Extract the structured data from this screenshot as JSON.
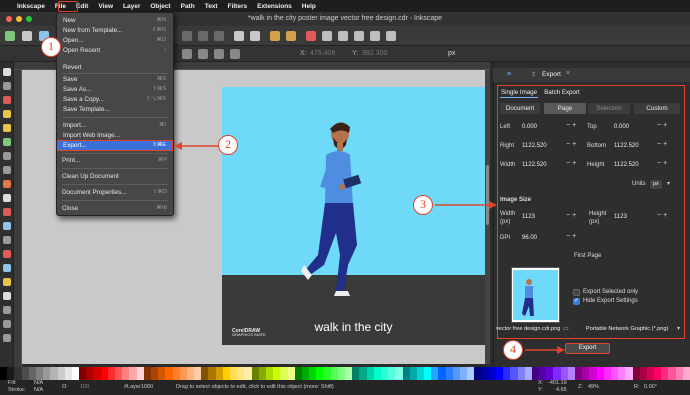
{
  "menubar": {
    "apple": "",
    "items": [
      "Inkscape",
      "File",
      "Edit",
      "View",
      "Layer",
      "Object",
      "Path",
      "Text",
      "Filters",
      "Extensions",
      "Help"
    ]
  },
  "window": {
    "title": "*walk in the city poster image vector free design.cdr - Inkscape"
  },
  "toolctl": {
    "x_label": "X:",
    "x_value": "475.408",
    "y_label": "Y:",
    "y_value": "392.300",
    "unit": "px"
  },
  "file_menu": {
    "items": [
      {
        "label": "New",
        "key": "⌘N"
      },
      {
        "label": "New from Template...",
        "key": "⇧⌘N"
      },
      {
        "label": "Open...",
        "key": "⌘O"
      },
      {
        "label": "Open Recent",
        "key": "›"
      },
      {
        "label": "Revert",
        "key": ""
      },
      {
        "label": "Save",
        "key": "⌘S"
      },
      {
        "label": "Save As...",
        "key": "⇧⌘S"
      },
      {
        "label": "Save a Copy...",
        "key": "⇧⌥⌘S"
      },
      {
        "label": "Save Template...",
        "key": ""
      },
      {
        "label": "Import...",
        "key": "⌘I"
      },
      {
        "label": "Import Web Image...",
        "key": ""
      },
      {
        "label": "Export...",
        "key": "⇧⌘E"
      },
      {
        "label": "Print...",
        "key": "⌘P"
      },
      {
        "label": "Clean Up Document",
        "key": ""
      },
      {
        "label": "Document Properties...",
        "key": "⇧⌘D"
      },
      {
        "label": "Close",
        "key": "⌘W"
      }
    ]
  },
  "poster": {
    "caption": "walk in the city",
    "brand_line1": "CorelDRAW",
    "brand_line2": "GRAPHICS SUITE"
  },
  "export_panel": {
    "tab_title": "Export",
    "close": "×",
    "mode_tabs": [
      "Single Image",
      "Batch Export"
    ],
    "area_tabs": [
      "Document",
      "Page",
      "Selection",
      "Custom"
    ],
    "fields": {
      "left_label": "Left",
      "left_value": "0.000",
      "top_label": "Top",
      "top_value": "0.000",
      "right_label": "Right",
      "right_value": "1122.520",
      "bottom_label": "Bottom",
      "bottom_value": "1122.520",
      "width_label": "Width",
      "width_value": "1122.520",
      "height_label": "Height",
      "height_value": "1122.520",
      "units_label": "Units",
      "units_value": "px"
    },
    "image_size_label": "Image Size",
    "img_width_label": "Width",
    "img_width_unit": "(px)",
    "img_width_value": "1123",
    "img_height_label": "Height",
    "img_height_unit": "(px)",
    "img_height_value": "1123",
    "dpi_label": "DPI",
    "dpi_value": "96.00",
    "page_select": "First Page",
    "export_selected_only": "Export Selected only",
    "hide_export_settings": "Hide Export Settings",
    "filename": "vector free design.cdr.png",
    "file_type": "Portable Network Graphic (*.png)",
    "export_button": "Export",
    "plus_minus": "−+"
  },
  "steps": [
    "1",
    "2",
    "3",
    "4"
  ],
  "status": {
    "fill_label": "Fill:",
    "fill_value": "N/A",
    "stroke_label": "Stroke:",
    "stroke_value": "N/A",
    "opacity_label": "O:",
    "opacity_value": "100",
    "layer": "#Layer1000",
    "hint": "Drag to select objects to edit, click to edit this object (more: Shift)",
    "x_label": "X:",
    "x_value": "-401.19",
    "y_label": "Y:",
    "y_value": "4.65",
    "zoom_label": "Z:",
    "zoom_value": "49%",
    "rot_label": "R:",
    "rot_value": "0.00°"
  },
  "colors": {
    "accent_red": "#e0452a",
    "highlight_blue": "#3d6fd8",
    "poster_sky": "#6ed9f9",
    "checkbox_blue": "#3a7be0"
  }
}
